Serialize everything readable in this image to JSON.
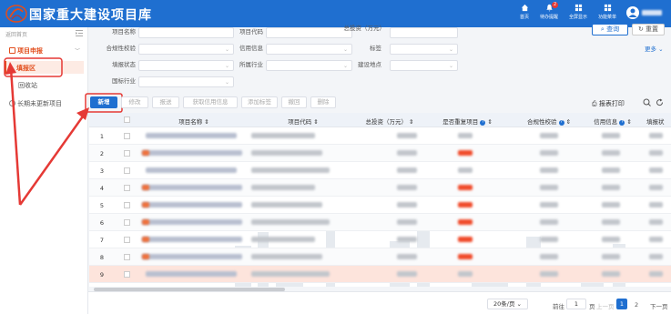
{
  "app": {
    "title": "国家重大建设项目库",
    "user_name": ""
  },
  "header_nav": [
    {
      "label": "首页",
      "icon": "home-icon"
    },
    {
      "label": "待办提醒",
      "icon": "bell-icon",
      "badge": "2"
    },
    {
      "label": "全屏显示",
      "icon": "fullscreen-icon"
    },
    {
      "label": "功能菜单",
      "icon": "grid-icon"
    }
  ],
  "sidebar": {
    "home_link": "返回首页",
    "group_label": "项目申报",
    "items": [
      {
        "label": "填报区"
      },
      {
        "label": "回收站"
      }
    ],
    "group2_label": "长期未更新项目"
  },
  "filters": {
    "project_name_label": "项目名称",
    "project_code_label": "项目代码",
    "total_investment_label": "总投资（万元）",
    "compliance_label": "合规性校验",
    "credit_label": "信用信息",
    "tag_label": "标签",
    "status_label": "填报状态",
    "industry_label": "所属行业",
    "location_label": "建设地点",
    "nat_industry_label": "国标行业",
    "query_button": "查询",
    "reset_button": "重置",
    "more_link": "更多"
  },
  "toolbar": {
    "new_button": "新增",
    "edit_button": "修改",
    "report_button": "报送",
    "credit_button": "获取信用信息",
    "add_tag_button": "添加标签",
    "withdraw_button": "撤回",
    "delete_button": "删除",
    "print_button": "报表打印"
  },
  "table": {
    "columns": [
      "项目名称",
      "项目代码",
      "总投资（万元）",
      "是否重复项目",
      "合规性校验",
      "信用信息",
      "填报状"
    ],
    "rows": [
      "1",
      "2",
      "3",
      "4",
      "5",
      "6",
      "7",
      "8",
      "9"
    ],
    "selected_row": "9"
  },
  "pager": {
    "page_size": "20条/页",
    "goto_label": "前往",
    "goto_value": "1",
    "page_suffix": "页",
    "prev_label": "上一页",
    "current_page": "1",
    "page2": "2",
    "next_label": "下一页"
  },
  "colors": {
    "primary": "#1f6fd0",
    "accent": "#e24d1c",
    "danger": "#e53935"
  }
}
